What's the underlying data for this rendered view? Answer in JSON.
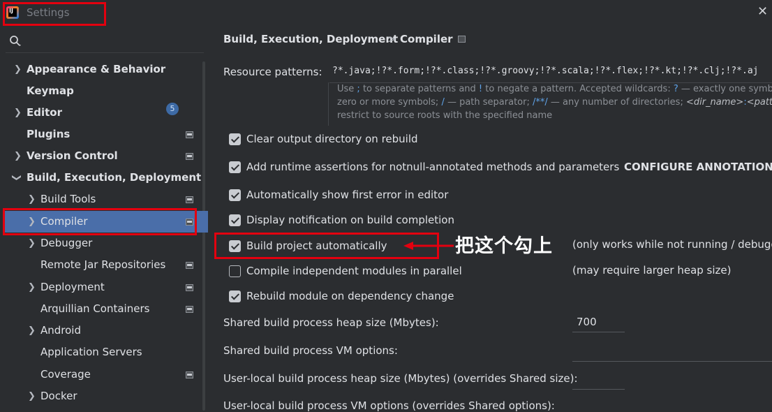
{
  "window": {
    "title": "Settings",
    "app_icon": "intellij-idea-icon",
    "close_glyph": "✕"
  },
  "sidebar": {
    "search_icon": "search-icon",
    "items": [
      {
        "label": "Appearance & Behavior",
        "bold": true,
        "chevron": ">"
      },
      {
        "label": "Keymap",
        "bold": true
      },
      {
        "label": "Editor",
        "bold": true,
        "chevron": ">"
      },
      {
        "label": "Plugins",
        "bold": true,
        "badge": "5"
      },
      {
        "label": "Version Control",
        "bold": true,
        "chevron": ">"
      },
      {
        "label": "Build, Execution, Deployment",
        "bold": true,
        "chevron": "v"
      },
      {
        "label": "Build Tools",
        "chevron": ">"
      },
      {
        "label": "Compiler",
        "chevron": ">",
        "selected": true
      },
      {
        "label": "Debugger",
        "chevron": ">"
      },
      {
        "label": "Remote Jar Repositories"
      },
      {
        "label": "Deployment",
        "chevron": ">"
      },
      {
        "label": "Arquillian Containers"
      },
      {
        "label": "Android",
        "chevron": ">"
      },
      {
        "label": "Application Servers"
      },
      {
        "label": "Coverage"
      },
      {
        "label": "Docker",
        "chevron": ">"
      }
    ]
  },
  "breadcrumb": {
    "parent": "Build, Execution, Deployment",
    "separator": ">",
    "current": "Compiler"
  },
  "resource_patterns": {
    "label": "Resource patterns:",
    "value": "?*.java;!?*.form;!?*.class;!?*.groovy;!?*.scala;!?*.flex;!?*.kt;!?*.clj;!?*.aj"
  },
  "hint": {
    "p1": "Use ",
    "semi": ";",
    "p2": " to separate patterns and ",
    "bang": "!",
    "p3": " to negate a pattern. Accepted wildcards: ",
    "q": "?",
    "p4": " — exactly one symbol; ",
    "star": "*",
    "p5": " —",
    "p6": "zero or more symbols; ",
    "slash": "/",
    "p7": " — path separator; ",
    "dstar": "/**/",
    "p8": " — any number of directories; ",
    "dir": "<dir_name>",
    "colon": ":",
    "pat": "<pattern>",
    "p9": " —",
    "p10": "restrict to source roots with the specified name"
  },
  "options": [
    {
      "label": "Clear output directory on rebuild",
      "checked": true
    },
    {
      "label": "Add runtime assertions for notnull-annotated methods and parameters",
      "checked": true
    },
    {
      "label": "Automatically show first error in editor",
      "checked": true
    },
    {
      "label": "Display notification on build completion",
      "checked": true
    },
    {
      "label": "Build project automatically",
      "checked": true
    },
    {
      "label": "Compile independent modules in parallel",
      "checked": false
    },
    {
      "label": "Rebuild module on dependency change",
      "checked": true
    }
  ],
  "configure_annotations": "CONFIGURE ANNOTATIONS",
  "build_auto_note": "(only works while not running / debugg",
  "parallel_note": "(may require larger heap size)",
  "annotation_text": "把这个勾上",
  "fields": {
    "heap_label": "Shared build process heap size (Mbytes):",
    "heap_value": "700",
    "vm_label": "Shared build process VM options:",
    "vm_value": "",
    "user_heap_label": "User-local build process heap size (Mbytes) (overrides Shared size):",
    "user_heap_value": "",
    "user_vm_label": "User-local build process VM options (overrides Shared options):"
  },
  "colors": {
    "highlight_red": "#e3000f",
    "selection_blue": "#4a6ea9",
    "link_blue": "#5fa3e8"
  }
}
